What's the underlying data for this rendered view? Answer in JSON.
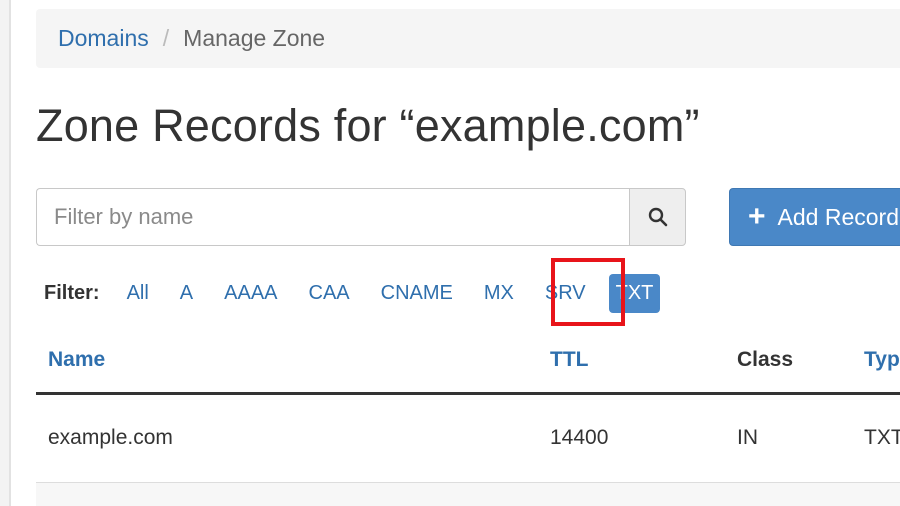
{
  "breadcrumb": {
    "parent": "Domains",
    "separator": "/",
    "current": "Manage Zone"
  },
  "page_title": "Zone Records for “example.com”",
  "search": {
    "placeholder": "Filter by name",
    "value": "",
    "icon": "search-icon"
  },
  "add_record": {
    "icon": "plus-icon",
    "label": "Add Record"
  },
  "filter": {
    "label": "Filter:",
    "options": [
      "All",
      "A",
      "AAAA",
      "CAA",
      "CNAME",
      "MX",
      "SRV",
      "TXT"
    ],
    "selected": "TXT"
  },
  "table": {
    "columns": [
      "Name",
      "TTL",
      "Class",
      "Typ"
    ],
    "rows": [
      [
        "example.com",
        "14400",
        "IN",
        "TXT"
      ]
    ]
  },
  "colors": {
    "accent": "#4a88c8",
    "link": "#2f6fad",
    "highlight": "#e8141a"
  }
}
